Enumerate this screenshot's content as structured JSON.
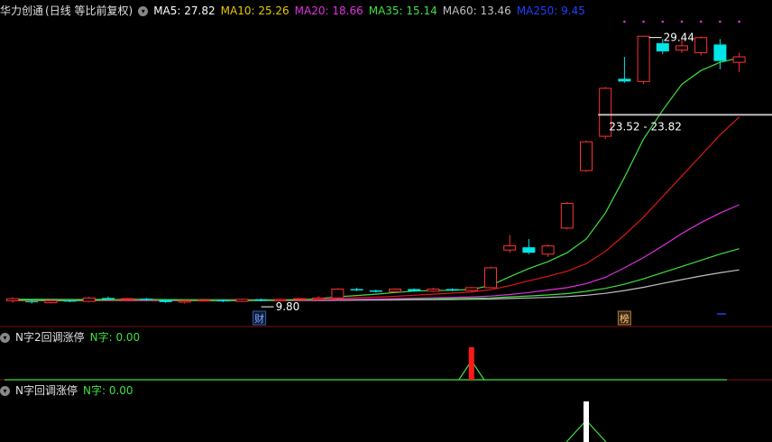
{
  "header": {
    "stock": "华力创通",
    "mode": "(日线 等比前复权)",
    "ma": [
      {
        "label": "MA5: 27.82",
        "color": "#ffffff"
      },
      {
        "label": "MA10: 25.26",
        "color": "#e8c800"
      },
      {
        "label": "MA20: 18.66",
        "color": "#e030e0"
      },
      {
        "label": "MA35: 15.14",
        "color": "#40e040"
      },
      {
        "label": "MA60: 13.46",
        "color": "#c0c0c0"
      },
      {
        "label": "MA250: 9.45",
        "color": "#2040ff"
      }
    ]
  },
  "colors": {
    "up": "#ff3333",
    "down": "#00e5e5",
    "ma5": "#40e040",
    "ma10": "#e01818",
    "ma20": "#e030e0",
    "ma35": "#40e040",
    "ma60": "#c0c0c0",
    "ma250": "#2040ff"
  },
  "annotations": {
    "high": "29.44",
    "low": "9.80",
    "zone": "23.52 - 23.82",
    "tag_cai": "财",
    "tag_bang": "榜"
  },
  "panel2": {
    "title": "N字2回调涨停",
    "value": "N字: 0.00"
  },
  "panel3": {
    "title": "N字回调涨停",
    "value": "N字: 0.00"
  },
  "chart_data": {
    "type": "candlestick",
    "ylim": [
      9.4,
      30.6
    ],
    "candles": [
      {
        "o": 10.1,
        "c": 10.25,
        "h": 10.35,
        "l": 9.95
      },
      {
        "o": 10.05,
        "c": 10.0,
        "h": 10.1,
        "l": 9.9
      },
      {
        "o": 9.95,
        "c": 10.1,
        "h": 10.2,
        "l": 9.9
      },
      {
        "o": 10.1,
        "c": 10.05,
        "h": 10.2,
        "l": 10.0
      },
      {
        "o": 10.05,
        "c": 10.3,
        "h": 10.4,
        "l": 10.0
      },
      {
        "o": 10.3,
        "c": 10.2,
        "h": 10.4,
        "l": 10.15
      },
      {
        "o": 10.2,
        "c": 10.25,
        "h": 10.3,
        "l": 10.15
      },
      {
        "o": 10.25,
        "c": 10.15,
        "h": 10.3,
        "l": 10.1
      },
      {
        "o": 10.15,
        "c": 10.0,
        "h": 10.2,
        "l": 9.95
      },
      {
        "o": 10.0,
        "c": 10.1,
        "h": 10.15,
        "l": 9.9
      },
      {
        "o": 10.1,
        "c": 10.15,
        "h": 10.2,
        "l": 10.05
      },
      {
        "o": 10.15,
        "c": 10.05,
        "h": 10.2,
        "l": 10.0
      },
      {
        "o": 10.05,
        "c": 10.2,
        "h": 10.25,
        "l": 10.0
      },
      {
        "o": 10.2,
        "c": 10.1,
        "h": 10.25,
        "l": 10.05
      },
      {
        "o": 10.1,
        "c": 10.2,
        "h": 10.25,
        "l": 10.05
      },
      {
        "o": 10.2,
        "c": 10.25,
        "h": 10.3,
        "l": 10.15
      },
      {
        "o": 10.2,
        "c": 10.3,
        "h": 10.4,
        "l": 10.15
      },
      {
        "o": 10.3,
        "c": 10.95,
        "h": 11.0,
        "l": 10.2
      },
      {
        "o": 10.95,
        "c": 10.85,
        "h": 11.05,
        "l": 10.8
      },
      {
        "o": 10.85,
        "c": 10.75,
        "h": 10.9,
        "l": 10.7
      },
      {
        "o": 10.75,
        "c": 10.95,
        "h": 11.0,
        "l": 10.7
      },
      {
        "o": 10.95,
        "c": 10.8,
        "h": 11.0,
        "l": 10.75
      },
      {
        "o": 10.8,
        "c": 10.95,
        "h": 11.05,
        "l": 10.75
      },
      {
        "o": 10.95,
        "c": 10.85,
        "h": 11.0,
        "l": 10.8
      },
      {
        "o": 10.85,
        "c": 11.05,
        "h": 11.1,
        "l": 10.8
      },
      {
        "o": 11.05,
        "c": 12.5,
        "h": 12.6,
        "l": 11.0
      },
      {
        "o": 13.8,
        "c": 14.1,
        "h": 14.9,
        "l": 13.6
      },
      {
        "o": 14.0,
        "c": 13.6,
        "h": 14.6,
        "l": 13.5
      },
      {
        "o": 13.5,
        "c": 14.1,
        "h": 14.2,
        "l": 13.3
      },
      {
        "o": 15.4,
        "c": 17.2,
        "h": 17.3,
        "l": 15.3
      },
      {
        "o": 19.6,
        "c": 21.7,
        "h": 21.8,
        "l": 19.5
      },
      {
        "o": 22.1,
        "c": 25.6,
        "h": 25.7,
        "l": 21.9
      },
      {
        "o": 26.3,
        "c": 26.1,
        "h": 27.9,
        "l": 26.0
      },
      {
        "o": 26.1,
        "c": 29.4,
        "h": 29.44,
        "l": 25.9
      },
      {
        "o": 28.9,
        "c": 28.3,
        "h": 29.2,
        "l": 28.1
      },
      {
        "o": 28.4,
        "c": 28.7,
        "h": 29.3,
        "l": 28.2
      },
      {
        "o": 28.2,
        "c": 29.3,
        "h": 29.4,
        "l": 28.0
      },
      {
        "o": 28.8,
        "c": 27.6,
        "h": 29.2,
        "l": 27.0
      },
      {
        "o": 27.5,
        "c": 27.9,
        "h": 28.2,
        "l": 26.8
      }
    ],
    "ma5": [
      10.15,
      10.15,
      10.12,
      10.1,
      10.14,
      10.18,
      10.2,
      10.21,
      10.18,
      10.14,
      10.12,
      10.1,
      10.12,
      10.14,
      10.14,
      10.18,
      10.24,
      10.38,
      10.48,
      10.58,
      10.7,
      10.8,
      10.84,
      10.86,
      10.92,
      11.22,
      11.85,
      12.45,
      12.95,
      13.6,
      14.6,
      16.5,
      19.1,
      21.9,
      24.0,
      25.9,
      26.9,
      27.5,
      27.82
    ],
    "ma10": [
      10.1,
      10.12,
      10.12,
      10.12,
      10.13,
      10.14,
      10.15,
      10.16,
      10.16,
      10.15,
      10.15,
      10.14,
      10.14,
      10.15,
      10.15,
      10.16,
      10.18,
      10.25,
      10.32,
      10.36,
      10.42,
      10.5,
      10.58,
      10.66,
      10.74,
      10.9,
      11.2,
      11.55,
      11.88,
      12.25,
      12.8,
      13.7,
      14.9,
      16.2,
      17.7,
      19.2,
      20.7,
      22.2,
      23.5
    ],
    "ma20": [
      10.15,
      10.15,
      10.15,
      10.14,
      10.14,
      10.14,
      10.14,
      10.14,
      10.14,
      10.14,
      10.14,
      10.14,
      10.14,
      10.14,
      10.14,
      10.14,
      10.15,
      10.18,
      10.2,
      10.22,
      10.25,
      10.28,
      10.31,
      10.34,
      10.38,
      10.44,
      10.55,
      10.7,
      10.88,
      11.05,
      11.35,
      11.8,
      12.5,
      13.25,
      14.1,
      15.0,
      15.8,
      16.5,
      17.1
    ],
    "ma35": [
      10.2,
      10.2,
      10.2,
      10.19,
      10.19,
      10.19,
      10.18,
      10.18,
      10.18,
      10.18,
      10.18,
      10.18,
      10.17,
      10.17,
      10.17,
      10.17,
      10.17,
      10.18,
      10.19,
      10.2,
      10.21,
      10.22,
      10.24,
      10.26,
      10.28,
      10.31,
      10.38,
      10.45,
      10.52,
      10.62,
      10.78,
      11.0,
      11.3,
      11.7,
      12.15,
      12.6,
      13.05,
      13.5,
      13.9
    ],
    "ma60": [
      10.12,
      10.12,
      10.12,
      10.12,
      10.12,
      10.12,
      10.12,
      10.12,
      10.12,
      10.12,
      10.12,
      10.12,
      10.12,
      10.12,
      10.12,
      10.12,
      10.12,
      10.13,
      10.14,
      10.15,
      10.16,
      10.17,
      10.18,
      10.19,
      10.2,
      10.22,
      10.26,
      10.3,
      10.34,
      10.4,
      10.5,
      10.64,
      10.84,
      11.08,
      11.36,
      11.64,
      11.9,
      12.14,
      12.35
    ],
    "signal_index": 24,
    "signal_index_p3": 30,
    "high_index": 33,
    "low_index": 13,
    "zone_value": 23.67
  }
}
